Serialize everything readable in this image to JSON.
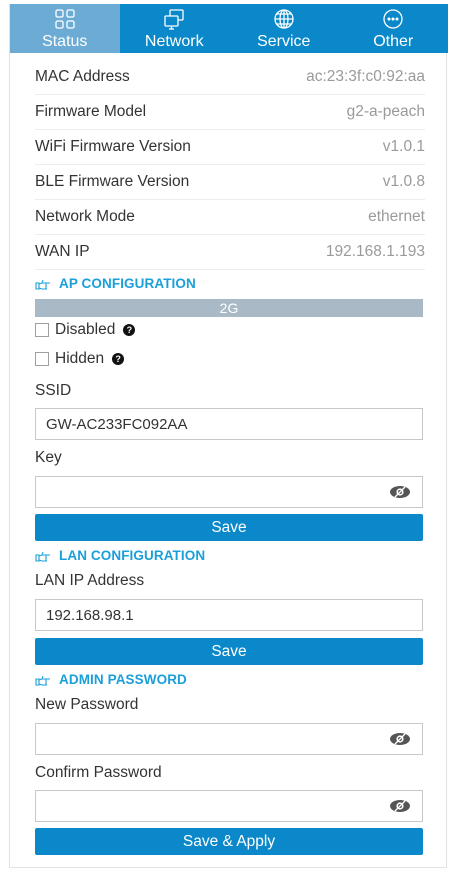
{
  "tabs": [
    {
      "label": "Status",
      "icon": "grid-icon",
      "active": true
    },
    {
      "label": "Network",
      "icon": "monitors-icon",
      "active": false
    },
    {
      "label": "Service",
      "icon": "globe-icon",
      "active": false
    },
    {
      "label": "Other",
      "icon": "more-icon",
      "active": false
    }
  ],
  "status": [
    {
      "label": "MAC Address",
      "value": "ac:23:3f:c0:92:aa"
    },
    {
      "label": "Firmware Model",
      "value": "g2-a-peach"
    },
    {
      "label": "WiFi Firmware Version",
      "value": "v1.0.1"
    },
    {
      "label": "BLE Firmware Version",
      "value": "v1.0.8"
    },
    {
      "label": "Network Mode",
      "value": "ethernet"
    },
    {
      "label": "WAN IP",
      "value": "192.168.1.193"
    }
  ],
  "ap": {
    "heading": "AP CONFIGURATION",
    "band": "2G",
    "disabled_label": "Disabled",
    "hidden_label": "Hidden",
    "help_glyph": "?",
    "ssid_label": "SSID",
    "ssid_value": "GW-AC233FC092AA",
    "key_label": "Key",
    "key_value": "",
    "save_label": "Save"
  },
  "lan": {
    "heading": "LAN CONFIGURATION",
    "ip_label": "LAN IP Address",
    "ip_value": "192.168.98.1",
    "save_label": "Save"
  },
  "admin": {
    "heading": "ADMIN PASSWORD",
    "new_label": "New Password",
    "new_value": "",
    "confirm_label": "Confirm Password",
    "confirm_value": "",
    "save_label": "Save & Apply"
  },
  "colors": {
    "primary": "#0a88c9",
    "tab_active": "#6cacd4",
    "section_heading": "#1a9fd9",
    "band": "#a9b9c6"
  }
}
